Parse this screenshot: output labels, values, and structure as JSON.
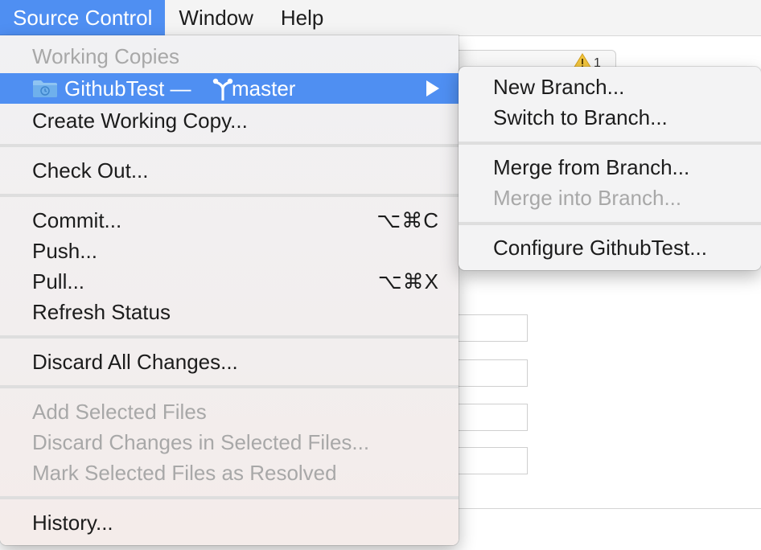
{
  "menubar": {
    "items": [
      {
        "label": "Source Control",
        "active": true
      },
      {
        "label": "Window",
        "active": false
      },
      {
        "label": "Help",
        "active": false
      }
    ]
  },
  "background": {
    "warning_count": "1"
  },
  "menu": {
    "working_copies_header": "Working Copies",
    "repo_item": {
      "repo": "GithubTest",
      "dash": "—",
      "branch": "master"
    },
    "create_working_copy": "Create Working Copy...",
    "check_out": "Check Out...",
    "commit": {
      "label": "Commit...",
      "shortcut": "⌥⌘C"
    },
    "push": {
      "label": "Push..."
    },
    "pull": {
      "label": "Pull...",
      "shortcut": "⌥⌘X"
    },
    "refresh_status": "Refresh Status",
    "discard_all": "Discard All Changes...",
    "add_selected": "Add Selected Files",
    "discard_selected": "Discard Changes in Selected Files...",
    "mark_resolved": "Mark Selected Files as Resolved",
    "history": "History..."
  },
  "submenu": {
    "new_branch": "New Branch...",
    "switch_branch": "Switch to Branch...",
    "merge_from": "Merge from Branch...",
    "merge_into": "Merge into Branch...",
    "configure": "Configure GithubTest..."
  },
  "colors": {
    "accent": "#4f8ff2",
    "disabled_text": "#a8a8a8"
  }
}
